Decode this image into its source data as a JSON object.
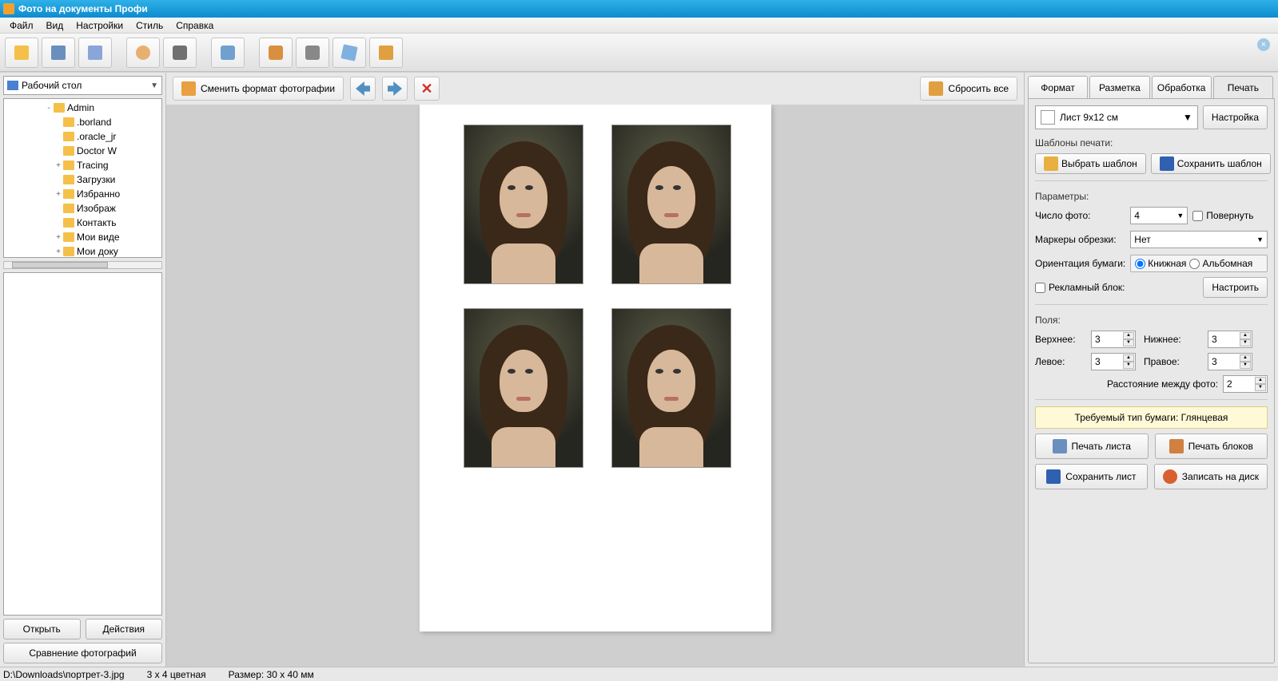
{
  "window": {
    "title": "Фото на документы Профи"
  },
  "menu": {
    "file": "Файл",
    "view": "Вид",
    "settings": "Настройки",
    "style": "Стиль",
    "help": "Справка"
  },
  "left": {
    "root_dropdown": "Рабочий стол",
    "tree": [
      {
        "indent": 4,
        "exp": "-",
        "label": "Admin"
      },
      {
        "indent": 5,
        "exp": "",
        "label": ".borland"
      },
      {
        "indent": 5,
        "exp": "",
        "label": ".oracle_jr"
      },
      {
        "indent": 5,
        "exp": "",
        "label": "Doctor W"
      },
      {
        "indent": 5,
        "exp": "+",
        "label": "Tracing"
      },
      {
        "indent": 5,
        "exp": "",
        "label": "Загрузки"
      },
      {
        "indent": 5,
        "exp": "+",
        "label": "Избранно"
      },
      {
        "indent": 5,
        "exp": "",
        "label": "Изображ"
      },
      {
        "indent": 5,
        "exp": "",
        "label": "Контакть"
      },
      {
        "indent": 5,
        "exp": "+",
        "label": "Мои виде"
      },
      {
        "indent": 5,
        "exp": "+",
        "label": "Мои доку"
      }
    ],
    "open": "Открыть",
    "actions": "Действия",
    "compare": "Сравнение фотографий"
  },
  "center": {
    "change_format": "Сменить формат фотографии",
    "reset_all": "Сбросить все"
  },
  "right": {
    "tabs": {
      "format": "Формат",
      "layout": "Разметка",
      "process": "Обработка",
      "print": "Печать"
    },
    "sheet_select": "Лист 9x12 см",
    "settings_btn": "Настройка",
    "templates_label": "Шаблоны печати:",
    "choose_template": "Выбрать шаблон",
    "save_template": "Сохранить шаблон",
    "params_label": "Параметры:",
    "photo_count": "Число фото:",
    "photo_count_val": "4",
    "rotate": "Повернуть",
    "crop_markers": "Маркеры обрезки:",
    "crop_val": "Нет",
    "orient": "Ориентация бумаги:",
    "orient_portrait": "Книжная",
    "orient_landscape": "Альбомная",
    "ad_block": "Рекламный блок:",
    "configure": "Настроить",
    "margins_label": "Поля:",
    "top": "Верхнее:",
    "top_v": "3",
    "bottom": "Нижнее:",
    "bottom_v": "3",
    "left": "Левое:",
    "left_v": "3",
    "rightm": "Правое:",
    "right_v": "3",
    "spacing": "Расстояние между фото:",
    "spacing_v": "2",
    "paper_required": "Требуемый тип бумаги: Глянцевая",
    "print_sheet": "Печать листа",
    "print_blocks": "Печать блоков",
    "save_sheet": "Сохранить лист",
    "write_disc": "Записать на диск"
  },
  "status": {
    "path": "D:\\Downloads\\портрет-3.jpg",
    "color": "3 x 4 цветная",
    "size": "Размер: 30 x 40 мм"
  }
}
